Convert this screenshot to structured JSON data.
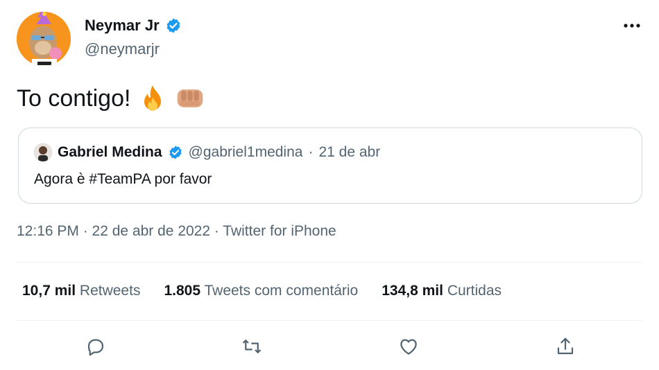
{
  "author": {
    "name": "Neymar Jr",
    "handle": "@neymarjr",
    "verified": true,
    "avatar_icon": "bored-ape-avatar-icon"
  },
  "tweet": {
    "text": "To contigo!",
    "emojis": [
      "fire-emoji-icon",
      "oncoming-fist-emoji-icon"
    ]
  },
  "quoted_tweet": {
    "name": "Gabriel Medina",
    "handle": "@gabriel1medina",
    "date": "21 de abr",
    "separator": "·",
    "text": "Agora è #TeamPA  por favor"
  },
  "timestamp": "12:16 PM · 22 de abr de 2022 · Twitter for iPhone",
  "stats": [
    {
      "value": "10,7 mil",
      "label": "Retweets"
    },
    {
      "value": "1.805",
      "label": "Tweets com comentário"
    },
    {
      "value": "134,8 mil",
      "label": "Curtidas"
    }
  ],
  "actions": [
    "reply-icon",
    "retweet-icon",
    "like-icon",
    "share-icon"
  ],
  "colors": {
    "accent": "#1d9bf0",
    "secondary_text": "#536471",
    "border": "#cfd9de",
    "avatar_bg": "#f7941d"
  }
}
